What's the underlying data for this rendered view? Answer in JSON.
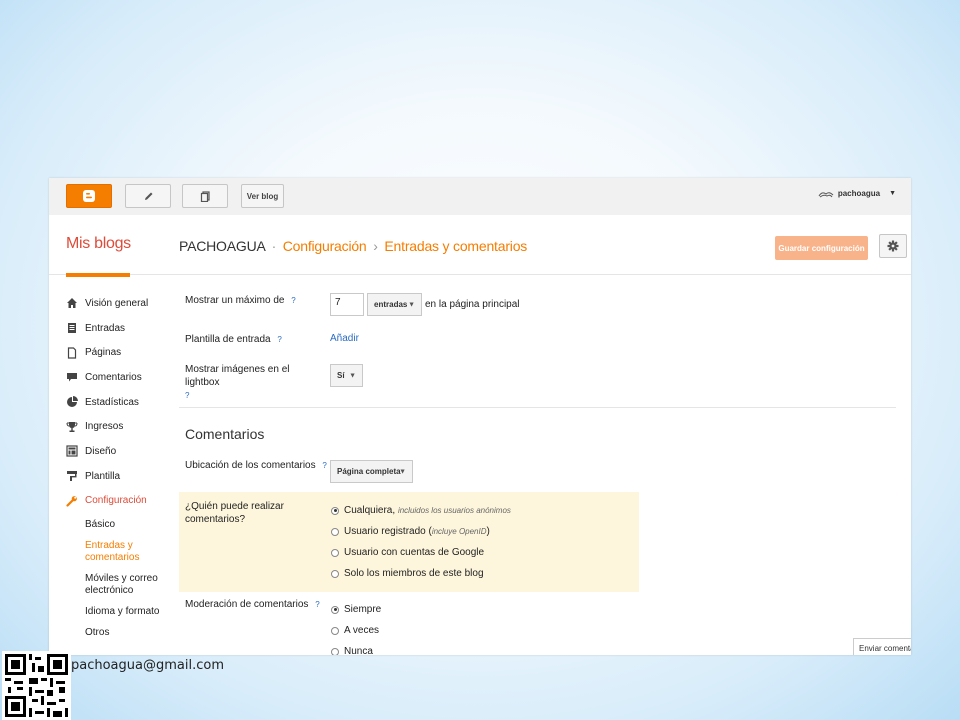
{
  "topbar": {
    "view_blog_label": "Ver blog",
    "username": "pachoagua"
  },
  "header": {
    "my_blogs": "Mis blogs",
    "blog_name": "PACHOAGUA",
    "sep1": "·",
    "crumb_config": "Configuración",
    "sep2": "›",
    "crumb_entries": "Entradas y comentarios",
    "save_label": "Guardar configuración"
  },
  "sidebar": {
    "items": [
      {
        "label": "Visión general",
        "icon": "home-icon"
      },
      {
        "label": "Entradas",
        "icon": "posts-icon"
      },
      {
        "label": "Páginas",
        "icon": "pages-icon"
      },
      {
        "label": "Comentarios",
        "icon": "comments-icon"
      },
      {
        "label": "Estadísticas",
        "icon": "stats-icon"
      },
      {
        "label": "Ingresos",
        "icon": "trophy-icon"
      },
      {
        "label": "Diseño",
        "icon": "layout-icon"
      },
      {
        "label": "Plantilla",
        "icon": "template-icon"
      },
      {
        "label": "Configuración",
        "icon": "wrench-icon"
      }
    ],
    "sub_items": [
      "Básico",
      "Entradas y comentarios",
      "Móviles y correo electrónico",
      "Idioma y formato",
      "Otros"
    ]
  },
  "settings": {
    "max_label": "Mostrar un máximo de",
    "max_value": "7",
    "max_unit": "entradas",
    "max_suffix": "en la página principal",
    "template_label": "Plantilla de entrada",
    "template_link": "Añadir",
    "lightbox_label": "Mostrar imágenes en el lightbox",
    "lightbox_value": "Sí",
    "help": "?"
  },
  "comments": {
    "section_title": "Comentarios",
    "location_label": "Ubicación de los comentarios",
    "location_value": "Página completa",
    "who_label": "¿Quién puede realizar comentarios?",
    "who_options": [
      {
        "label": "Cualquiera,",
        "note": "incluidos los usuarios anónimos"
      },
      {
        "label": "Usuario registrado (",
        "note": "incluye OpenID",
        "tail": ")"
      },
      {
        "label": "Usuario con cuentas de Google"
      },
      {
        "label": "Solo los miembros de este blog"
      }
    ],
    "moderation_label": "Moderación de comentarios",
    "moderation_options": [
      "Siempre",
      "A veces",
      "Nunca"
    ]
  },
  "feedback_button": "Enviar comentarios",
  "overlay": {
    "email": "pachoagua@gmail.com"
  }
}
